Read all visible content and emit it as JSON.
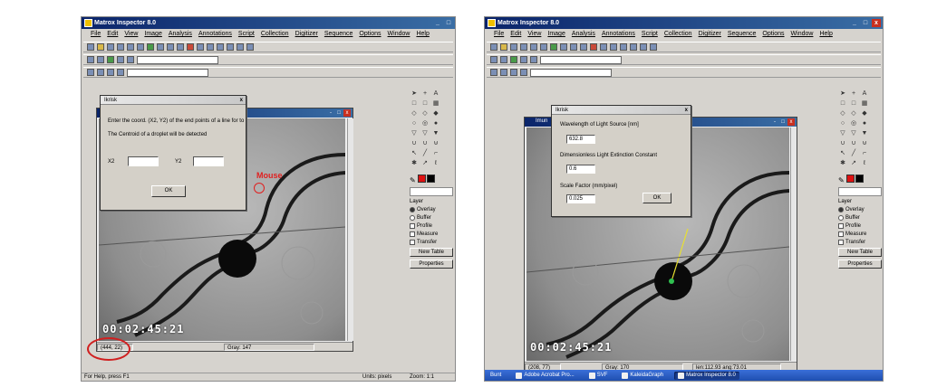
{
  "app_title": "Matrox Inspector 8.0",
  "menu": [
    "File",
    "Edit",
    "View",
    "Image",
    "Analysis",
    "Annotations",
    "Script",
    "Collection",
    "Digitizer",
    "Sequence",
    "Options",
    "Window",
    "Help"
  ],
  "left": {
    "dialog": {
      "title": "Ikrisk",
      "line1": "Enter the coord. (X2, Y2) of the end points of a line for to",
      "line2": "The Centroid of a droplet will be detected",
      "x2_label": "X2",
      "y2_label": "Y2",
      "x2_value": "",
      "y2_value": "",
      "ok": "OK"
    },
    "mouse_annotation": "Mouse",
    "timestamp": "00:02:45:21",
    "status_coord": "(444, 22)",
    "status_gray": "Gray: 147",
    "app_status": "For Help, press F1",
    "app_status_right1": "Units: pixels",
    "app_status_right2": "Zoom: 1:1"
  },
  "right": {
    "dialog": {
      "title": "Ikrisk",
      "wavelength_label": "Wavelength of Light Source [nm]",
      "wavelength_value": "632.8",
      "extinction_label": "Dimensionless Light Extinction Constant",
      "extinction_value": "0.6",
      "scale_label": "Scale Factor (mm/pixel)",
      "scale_value": "0.025",
      "ok": "OK"
    },
    "image_title": "Imun",
    "timestamp": "00:02:45:21",
    "status_coord": "(208, 77)",
    "status_gray": "Gray: 170",
    "status_len": "len:112.93 ang:73.01",
    "taskbar": [
      "Bunt",
      "Adobe Acrobat Pro...",
      "SVF",
      "KaleidaGraph",
      "Matrox Inspector 8.0"
    ]
  },
  "panel": {
    "layer_label": "Layer",
    "overlay": "Overlay",
    "buffer": "Buffer",
    "profile": "Profile",
    "measure": "Measure",
    "transfer": "Transfer",
    "new_table": "New Table",
    "properties": "Properties"
  },
  "colors": {
    "titlebar": "#0a246a",
    "annotation_red": "#e02020",
    "swatch_red": "#dd1111",
    "swatch_black": "#000000"
  }
}
